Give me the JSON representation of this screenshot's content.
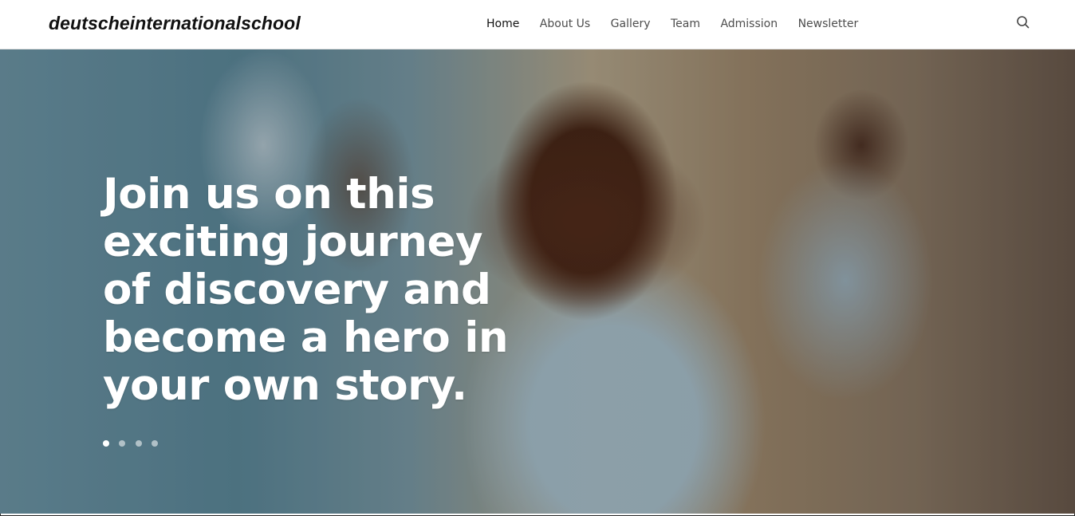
{
  "header": {
    "brand": "deutscheinternationalschool",
    "nav": [
      {
        "label": "Home",
        "active": true
      },
      {
        "label": "About Us"
      },
      {
        "label": "Gallery"
      },
      {
        "label": "Team"
      },
      {
        "label": "Admission"
      },
      {
        "label": "Newsletter"
      }
    ],
    "search_icon": "search-icon"
  },
  "hero": {
    "headline": "Join us on this exciting journey of discovery and become a hero in your own story.",
    "slides_total": 4,
    "active_slide": 1
  }
}
